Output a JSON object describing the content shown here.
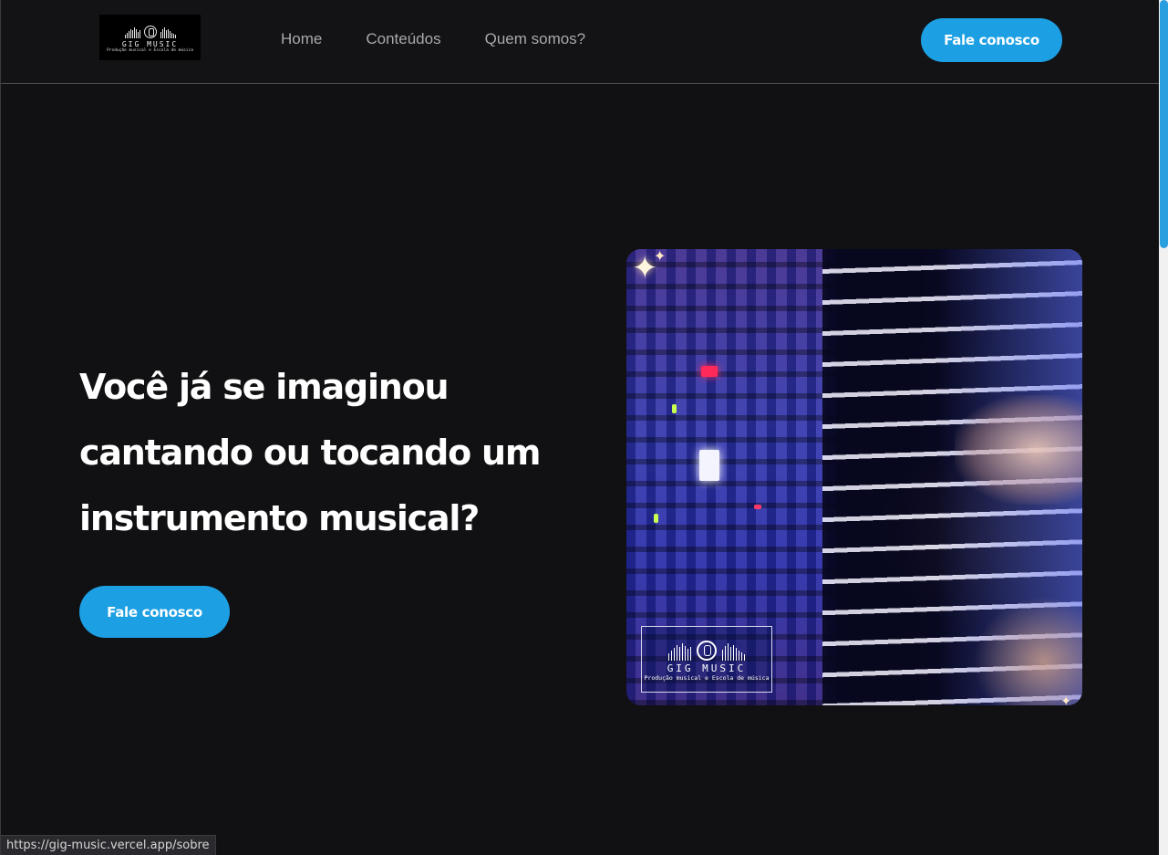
{
  "header": {
    "logo": {
      "brand": "GIG MUSIC",
      "tagline": "Produção musical e Escola de música"
    },
    "nav": [
      {
        "label": "Home"
      },
      {
        "label": "Conteúdos"
      },
      {
        "label": "Quem somos?"
      }
    ],
    "cta_label": "Fale conosco"
  },
  "hero": {
    "title": "Você já se imaginou cantando ou tocando um instrumento musical?",
    "cta_label": "Fale conosco",
    "image": {
      "description_icon": "piano-mixer-photo",
      "watermark_brand": "GIG MUSIC",
      "watermark_tagline": "Produção musical e Escola de música"
    }
  },
  "status_bar": {
    "url": "https://gig-music.vercel.app/sobre"
  },
  "colors": {
    "background": "#111113",
    "accent": "#1c9fe3",
    "nav_text": "#a9a9ad",
    "heading": "#ffffff"
  }
}
